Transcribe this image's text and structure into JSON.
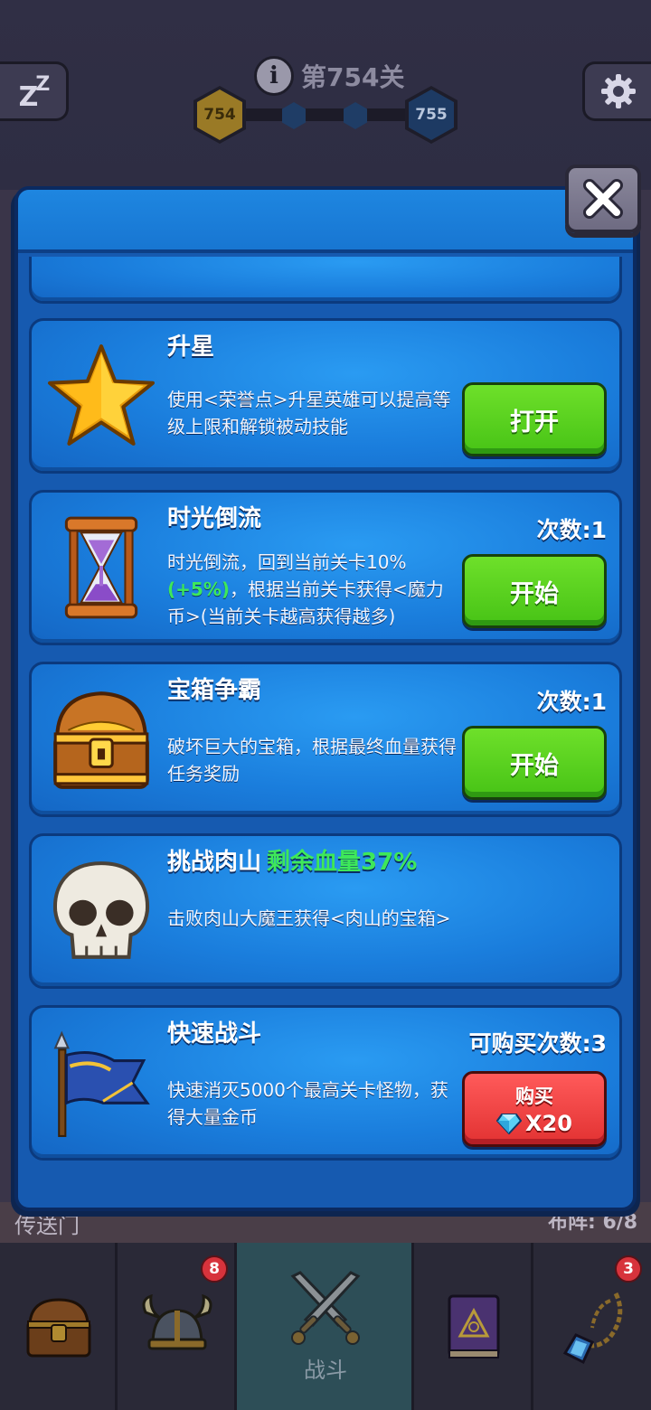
{
  "hud": {
    "level_title": "第754关",
    "current_level": "754",
    "next_level": "755"
  },
  "background": {
    "portal_text": "传送门",
    "right_text": "布阵: 6/8"
  },
  "cards": [
    {
      "id": "star-up",
      "title": "升星",
      "description": "使用<荣誉点>升星英雄可以提高等级上限和解锁被动技能",
      "button": "打开",
      "icon": "star-icon"
    },
    {
      "id": "time-rewind",
      "title": "时光倒流",
      "description_a": "时光倒流，回到当前关卡10%",
      "description_b": "(+5%)",
      "description_c": "，根据当前关卡获得<魔力币>(当前关卡越高获得越多)",
      "count": "次数:1",
      "button": "开始",
      "icon": "hourglass-icon"
    },
    {
      "id": "chest-battle",
      "title": "宝箱争霸",
      "description": "破坏巨大的宝箱，根据最终血量获得任务奖励",
      "count": "次数:1",
      "button": "开始",
      "icon": "treasure-chest-icon"
    },
    {
      "id": "meat-mountain",
      "title": "挑战肉山",
      "hp_text": "剩余血量37%",
      "hp_percent": 37,
      "description": "击败肉山大魔王获得<肉山的宝箱>",
      "icon": "skull-icon"
    },
    {
      "id": "quick-battle",
      "title": "快速战斗",
      "description": "快速消灭5000个最高关卡怪物，获得大量金币",
      "count": "可购买次数:3",
      "button": "购买",
      "price": "X20",
      "icon": "flag-icon"
    }
  ],
  "nav": {
    "tabs": [
      {
        "name": "chest",
        "icon": "treasure-chest-icon",
        "badge": ""
      },
      {
        "name": "heroes",
        "icon": "viking-helmet-icon",
        "badge": "8"
      },
      {
        "name": "battle",
        "icon": "crossed-swords-icon",
        "label": "战斗",
        "active": true
      },
      {
        "name": "spellbook",
        "icon": "spellbook-icon",
        "badge": ""
      },
      {
        "name": "amulet",
        "icon": "amulet-icon",
        "badge": "3"
      }
    ]
  },
  "colors": {
    "panel_blue": "#165ab0",
    "card_blue": "#1a7ddc",
    "button_green": "#47c316",
    "button_red": "#e23232",
    "accent_green_text": "#3ee85a"
  }
}
